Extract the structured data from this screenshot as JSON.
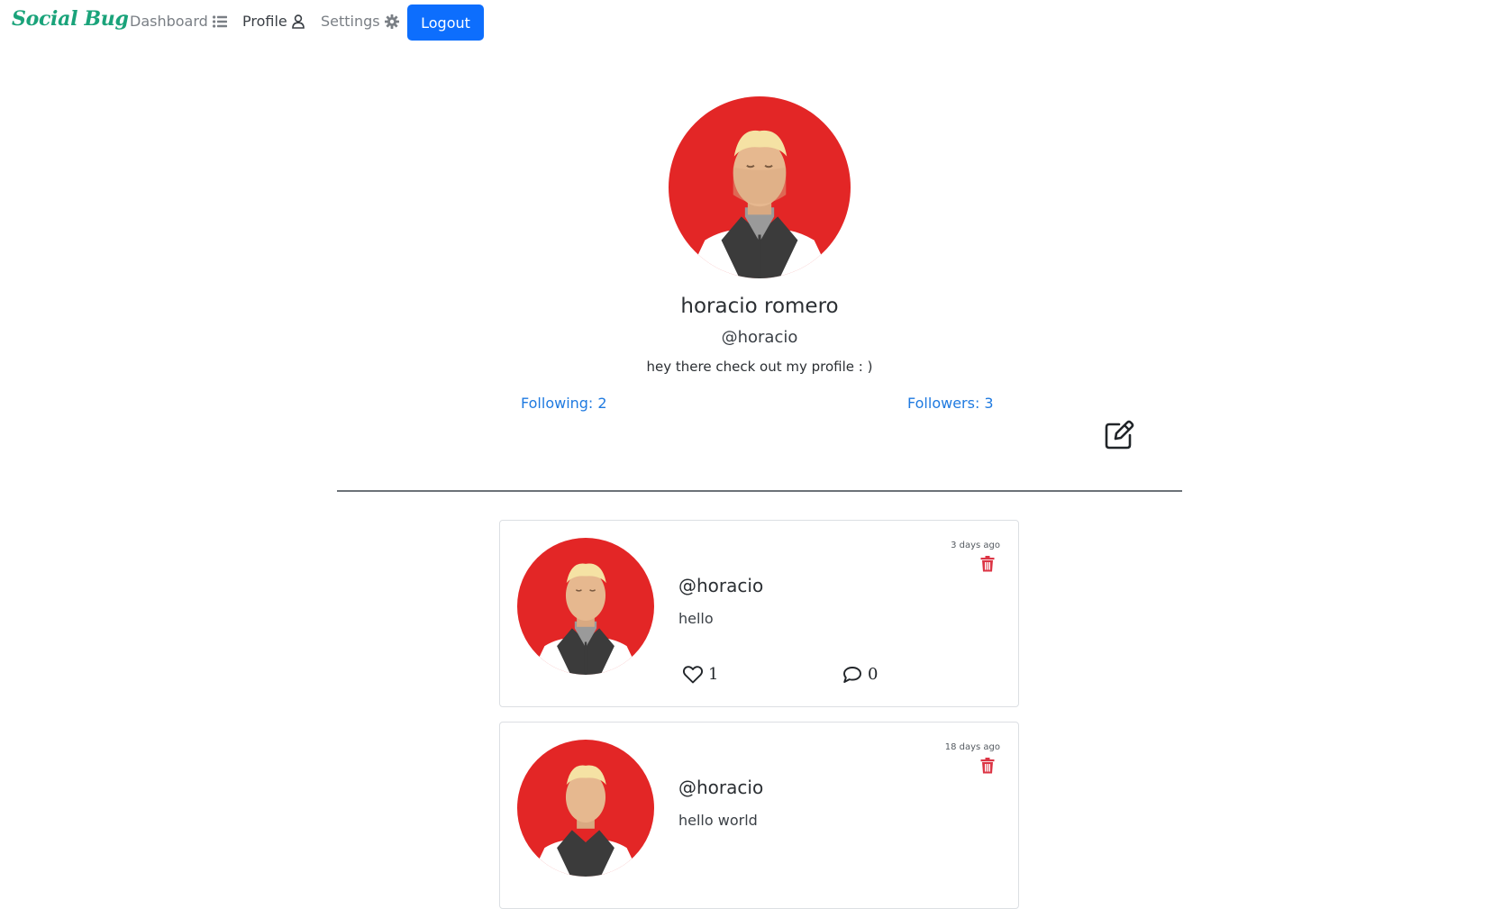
{
  "nav": {
    "brand": "Social Bug",
    "dashboard_label": "Dashboard",
    "profile_label": "Profile",
    "settings_label": "Settings",
    "logout_label": "Logout"
  },
  "profile": {
    "name": "horacio romero",
    "handle": "@horacio",
    "bio": "hey there check out my profile : )",
    "following_label": "Following: 2",
    "followers_label": "Followers: 3"
  },
  "posts": [
    {
      "time": "3 days ago",
      "user": "@horacio",
      "text": "hello",
      "likes": "1",
      "comments": "0"
    },
    {
      "time": "18 days ago",
      "user": "@horacio",
      "text": "hello world"
    }
  ],
  "colors": {
    "brand": "#1aa37a",
    "primary": "#0d6efd",
    "link": "#1f7ae0",
    "avatar_bg": "#e32626",
    "danger": "#dc3545"
  },
  "icons": [
    "list-icon",
    "user-icon",
    "gear-icon",
    "edit-icon",
    "trash-icon",
    "heart-icon",
    "comment-icon"
  ]
}
